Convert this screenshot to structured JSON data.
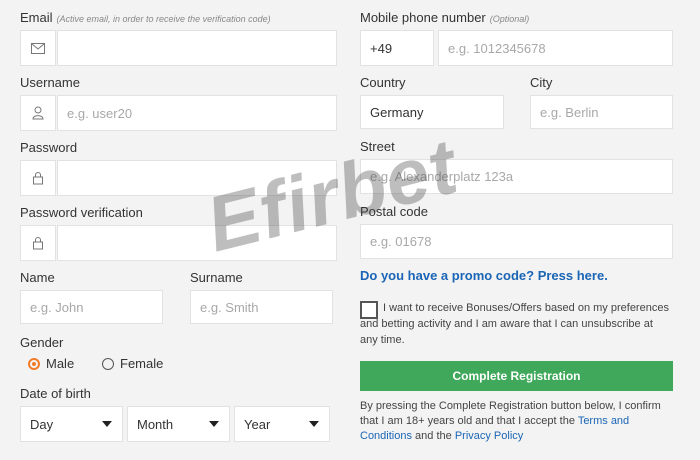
{
  "form": {
    "email": {
      "label": "Email",
      "hint": "(Active email, in order to receive the verification code)",
      "value": "",
      "icon": "envelope-icon"
    },
    "username": {
      "label": "Username",
      "placeholder": "e.g. user20",
      "icon": "user-icon"
    },
    "password": {
      "label": "Password",
      "icon": "lock-icon"
    },
    "password_verification": {
      "label": "Password verification",
      "icon": "lock-icon"
    },
    "name": {
      "label": "Name",
      "placeholder": "e.g. John"
    },
    "surname": {
      "label": "Surname",
      "placeholder": "e.g. Smith"
    },
    "gender": {
      "label": "Gender",
      "options": [
        {
          "label": "Male",
          "selected": true
        },
        {
          "label": "Female",
          "selected": false
        }
      ]
    },
    "dob": {
      "label": "Date of birth",
      "day": "Day",
      "month": "Month",
      "year": "Year"
    },
    "phone": {
      "label": "Mobile phone number",
      "hint": "(Optional)",
      "prefix": "+49",
      "placeholder": "e.g. 1012345678"
    },
    "country": {
      "label": "Country",
      "value": "Germany"
    },
    "city": {
      "label": "City",
      "placeholder": "e.g. Berlin"
    },
    "street": {
      "label": "Street",
      "placeholder": "e.g. Alexanderplatz 123a"
    },
    "postal": {
      "label": "Postal code",
      "placeholder": "e.g. 01678"
    },
    "promo_link": "Do you have a promo code? Press here.",
    "consent_text": "I want to receive Bonuses/Offers based on my preferences and betting activity and I am aware that I can unsubscribe at any time.",
    "submit_label": "Complete Registration",
    "terms": {
      "before": "By pressing the Complete Registration button below, I confirm that I am 18+ years old and that I accept the ",
      "terms_link": "Terms and Conditions",
      "middle": " and the ",
      "privacy_link": "Privacy Policy"
    }
  },
  "watermark": "Efirbet",
  "colors": {
    "accent": "#f07c2a",
    "submit": "#3fa85a",
    "link": "#1a65b5"
  }
}
